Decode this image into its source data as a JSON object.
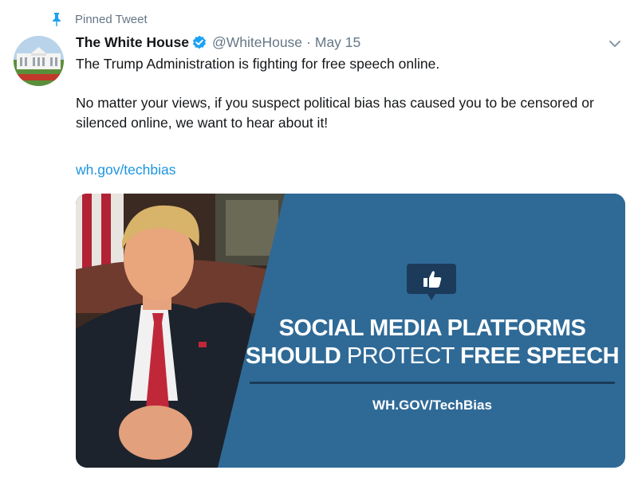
{
  "pinned": {
    "label": "Pinned Tweet",
    "icon": "pin-icon"
  },
  "tweet": {
    "author_name": "The White House",
    "handle": "@WhiteHouse",
    "separator": "·",
    "date": "May 15",
    "text_line1": "The Trump Administration is fighting for free speech online.",
    "text_para2": "No matter your views, if you suspect political bias has caused you to be censored or silenced online, we want to hear about it!",
    "link": "wh.gov/techbias"
  },
  "media": {
    "headline_line1": "SOCIAL MEDIA PLATFORMS",
    "headline_should": "SHOULD",
    "headline_protect": "PROTECT",
    "headline_free_speech": "FREE SPEECH",
    "url_text": "WH.GOV/TechBias",
    "icon": "thumbs-up-icon"
  },
  "colors": {
    "link": "#1b95e0",
    "secondary_text": "#657786",
    "verified": "#1da1f2",
    "media_blue": "#2f6a97",
    "rule": "#1c3a5a"
  }
}
